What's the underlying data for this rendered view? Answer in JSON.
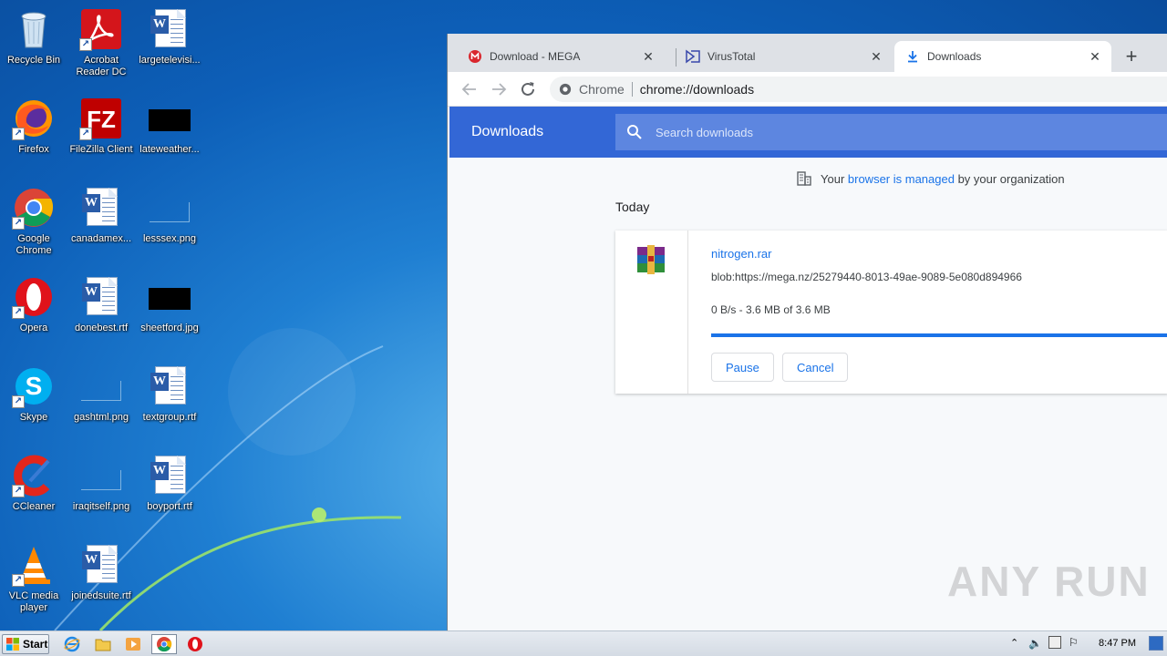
{
  "desktop": {
    "icons": [
      {
        "label": "Recycle Bin"
      },
      {
        "label": "Acrobat Reader DC"
      },
      {
        "label": "largetelevisi..."
      },
      {
        "label": "Firefox"
      },
      {
        "label": "FileZilla Client"
      },
      {
        "label": "lateweather..."
      },
      {
        "label": "Google Chrome"
      },
      {
        "label": "canadamex..."
      },
      {
        "label": "lesssex.png"
      },
      {
        "label": "Opera"
      },
      {
        "label": "donebest.rtf"
      },
      {
        "label": "sheetford.jpg"
      },
      {
        "label": "Skype"
      },
      {
        "label": "gashtml.png"
      },
      {
        "label": "textgroup.rtf"
      },
      {
        "label": "CCleaner"
      },
      {
        "label": "iraqitself.png"
      },
      {
        "label": "boyport.rtf"
      },
      {
        "label": "VLC media player"
      },
      {
        "label": "joinedsuite.rtf"
      }
    ]
  },
  "browser": {
    "tabs": [
      {
        "title": "Download - MEGA",
        "favicon": "mega-icon"
      },
      {
        "title": "VirusTotal",
        "favicon": "virustotal-icon"
      },
      {
        "title": "Downloads",
        "favicon": "download-icon"
      }
    ],
    "omnibox": {
      "site": "Chrome",
      "url": "chrome://downloads"
    },
    "downloads_page": {
      "title": "Downloads",
      "search_placeholder": "Search downloads",
      "managed": {
        "prefix": "Your ",
        "link": "browser is managed",
        "suffix": " by your organization"
      },
      "section": "Today",
      "item": {
        "filename": "nitrogen.rar",
        "url": "blob:https://mega.nz/25279440-8013-49ae-9089-5e080d894966",
        "status": "0 B/s - 3.6 MB of 3.6 MB",
        "progress": 1.0,
        "pause_label": "Pause",
        "cancel_label": "Cancel"
      }
    }
  },
  "watermark": "ANY RUN",
  "taskbar": {
    "start_label": "Start",
    "clock": "8:47 PM"
  },
  "colors": {
    "accent": "#3367d6",
    "link": "#1a73e8",
    "desktop": "#1f7fd2"
  }
}
